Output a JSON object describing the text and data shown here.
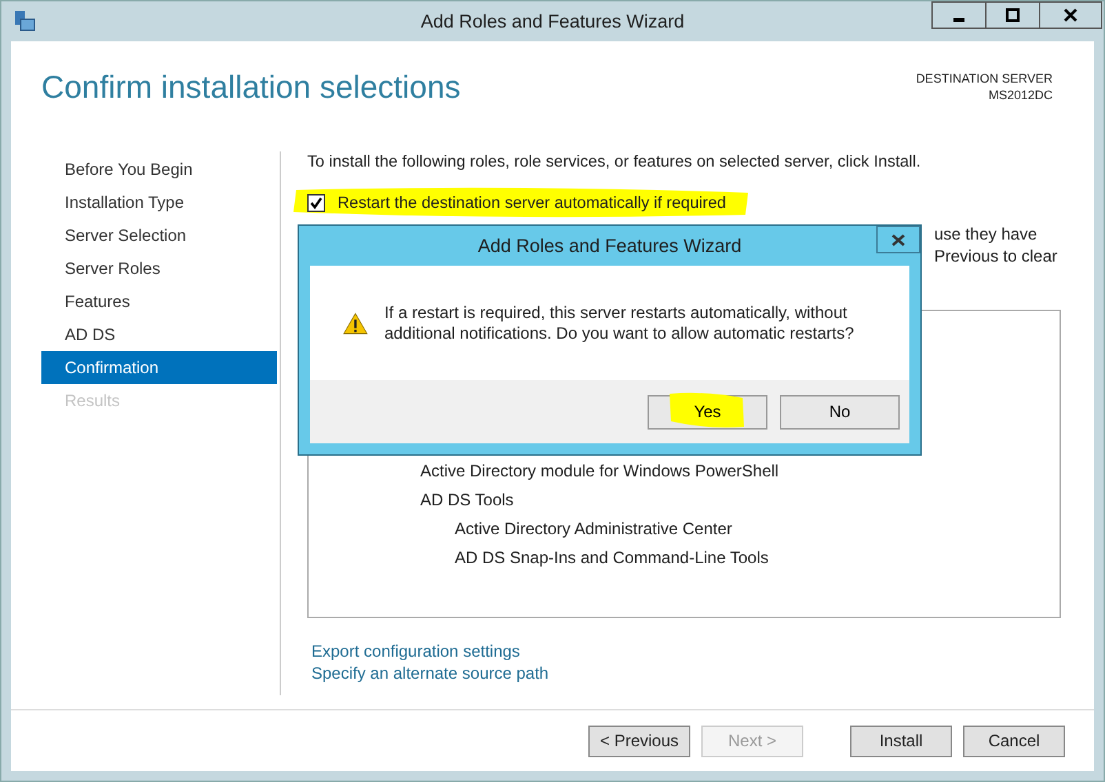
{
  "window": {
    "title": "Add Roles and Features Wizard"
  },
  "header": {
    "title": "Confirm installation selections",
    "server_label": "DESTINATION SERVER",
    "server_name": "MS2012DC"
  },
  "steps": [
    {
      "label": "Before You Begin",
      "selected": false,
      "disabled": false
    },
    {
      "label": "Installation Type",
      "selected": false,
      "disabled": false
    },
    {
      "label": "Server Selection",
      "selected": false,
      "disabled": false
    },
    {
      "label": "Server Roles",
      "selected": false,
      "disabled": false
    },
    {
      "label": "Features",
      "selected": false,
      "disabled": false
    },
    {
      "label": "AD DS",
      "selected": false,
      "disabled": false
    },
    {
      "label": "Confirmation",
      "selected": true,
      "disabled": false
    },
    {
      "label": "Results",
      "selected": false,
      "disabled": true
    }
  ],
  "intro": "To install the following roles, role services, or features on selected server, click Install.",
  "restart_option": {
    "label": "Restart the destination server automatically if required",
    "checked": true,
    "highlighted": true
  },
  "partial_lines": [
    "use they have",
    "Previous to clear"
  ],
  "features": [
    {
      "label": "Active Directory module for Windows PowerShell"
    },
    {
      "label": "AD DS Tools",
      "children": [
        {
          "label": "Active Directory Administrative Center"
        },
        {
          "label": "AD DS Snap-Ins and Command-Line Tools"
        }
      ]
    }
  ],
  "links": [
    "Export configuration settings",
    "Specify an alternate source path"
  ],
  "buttons": [
    {
      "label": "< Previous",
      "disabled": false
    },
    {
      "label": "Next >",
      "disabled": true
    },
    {
      "label": "Install",
      "disabled": false
    },
    {
      "label": "Cancel",
      "disabled": false
    }
  ],
  "dialog": {
    "title": "Add Roles and Features Wizard",
    "message": "If a restart is required, this server restarts automatically, without additional notifications. Do you want to allow automatic restarts?",
    "buttons": [
      {
        "label": "Yes",
        "highlighted": true
      },
      {
        "label": "No",
        "highlighted": false
      }
    ]
  }
}
